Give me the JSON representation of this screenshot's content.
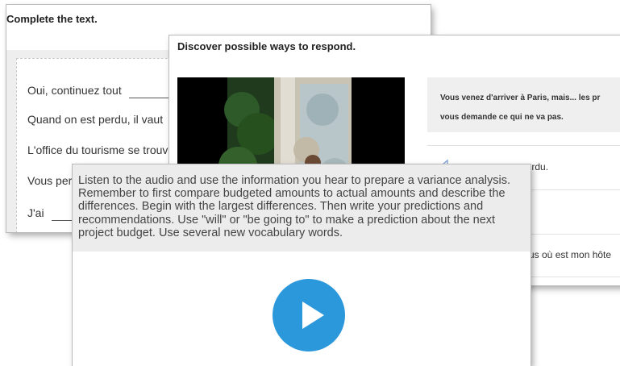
{
  "complete_text": {
    "title": "Complete the text.",
    "sentences": [
      "Oui, continuez tout",
      "Quand on est perdu, il vaut",
      "L'office du tourisme se trouve",
      "Vous per",
      "J'ai"
    ]
  },
  "discover": {
    "title": "Discover possible ways to respond.",
    "prompt_lines": [
      "Vous venez d'arriver à Paris, mais... les pr",
      "vous demande ce qui ne va pas."
    ],
    "responses": [
      "perdu.",
      "us où est mon hôte"
    ]
  },
  "audio_task": {
    "instructions": [
      "Listen to the audio and use the information you hear to prepare a variance analysis.",
      "Remember to first compare budgeted amounts to actual amounts and describe the",
      "differences. Begin with the largest differences. Then write your predictions and",
      "recommendations. Use \"will\" or \"be going to\" to make a prediction about the next",
      "project budget. Use several new vocabulary words."
    ],
    "play_button_color": "#2b98dc",
    "play_icon": "play-icon"
  }
}
